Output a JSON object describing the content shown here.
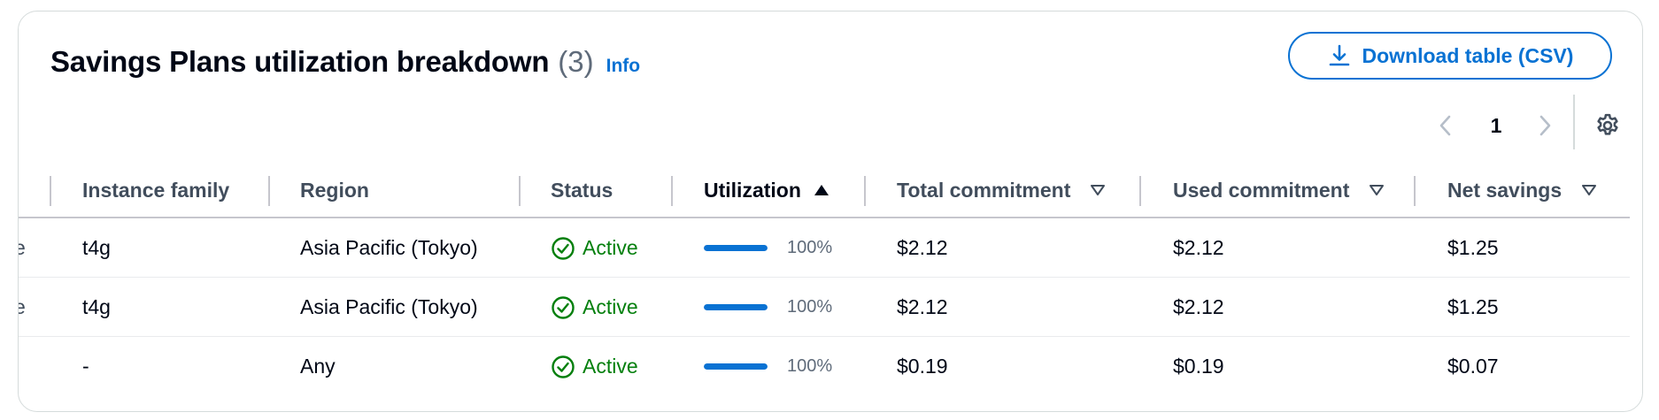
{
  "header": {
    "title": "Savings Plans utilization breakdown",
    "count": "(3)",
    "info": "Info",
    "download_label": "Download table (CSV)"
  },
  "pagination": {
    "current_page": "1"
  },
  "table": {
    "columns": {
      "instance_family": "Instance family",
      "region": "Region",
      "status": "Status",
      "utilization": "Utilization",
      "total_commitment": "Total commitment",
      "used_commitment": "Used commitment",
      "net_savings": "Net savings"
    },
    "sorted_column": "utilization",
    "sort_direction": "ascending",
    "rows": [
      {
        "clipped": "e",
        "instance_family": "t4g",
        "region": "Asia Pacific (Tokyo)",
        "status": "Active",
        "utilization": "100%",
        "utilization_fraction": 1.0,
        "total_commitment": "$2.12",
        "used_commitment": "$2.12",
        "net_savings": "$1.25"
      },
      {
        "clipped": "e",
        "instance_family": "t4g",
        "region": "Asia Pacific (Tokyo)",
        "status": "Active",
        "utilization": "100%",
        "utilization_fraction": 1.0,
        "total_commitment": "$2.12",
        "used_commitment": "$2.12",
        "net_savings": "$1.25"
      },
      {
        "clipped": "",
        "instance_family": "-",
        "region": "Any",
        "status": "Active",
        "utilization": "100%",
        "utilization_fraction": 1.0,
        "total_commitment": "$0.19",
        "used_commitment": "$0.19",
        "net_savings": "$0.07"
      }
    ]
  },
  "icons": {
    "download": "download-icon",
    "prev": "chevron-left-icon",
    "next": "chevron-right-icon",
    "settings": "gear-icon",
    "sort_asc": "caret-up-filled-icon",
    "sort_none": "caret-down-outline-icon",
    "status_ok": "check-circle-icon"
  },
  "colors": {
    "link": "#0972d3",
    "success": "#037f0c",
    "text": "#000716",
    "header_text": "#414d5c",
    "muted": "#5f6b7a",
    "border": "#d5dbdb"
  }
}
